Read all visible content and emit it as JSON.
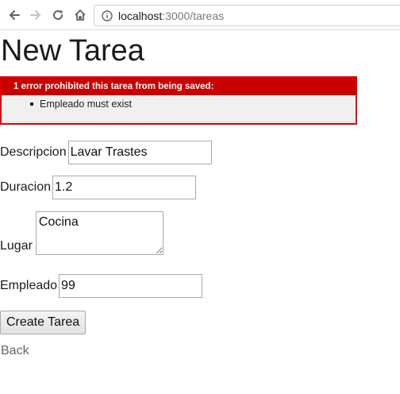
{
  "browser": {
    "url_host": "localhost",
    "url_rest": ":3000/tareas",
    "icons": [
      "back-icon",
      "forward-icon",
      "reload-icon",
      "home-icon",
      "info-icon"
    ]
  },
  "page": {
    "title": "New Tarea"
  },
  "errors": {
    "header": "1 error prohibited this tarea from being saved:",
    "items": [
      "Empleado must exist"
    ],
    "colors": {
      "header_bg": "#c80000",
      "border": "#e00000",
      "body_bg": "#f0f0f0"
    }
  },
  "form": {
    "descripcion": {
      "label": "Descripcion",
      "value": "Lavar Trastes"
    },
    "duracion": {
      "label": "Duracion",
      "value": "1.2"
    },
    "lugar": {
      "label": "Lugar",
      "value": "Cocina"
    },
    "empleado": {
      "label": "Empleado",
      "value": "99"
    },
    "submit_label": "Create Tarea"
  },
  "links": {
    "back_label": "Back"
  }
}
